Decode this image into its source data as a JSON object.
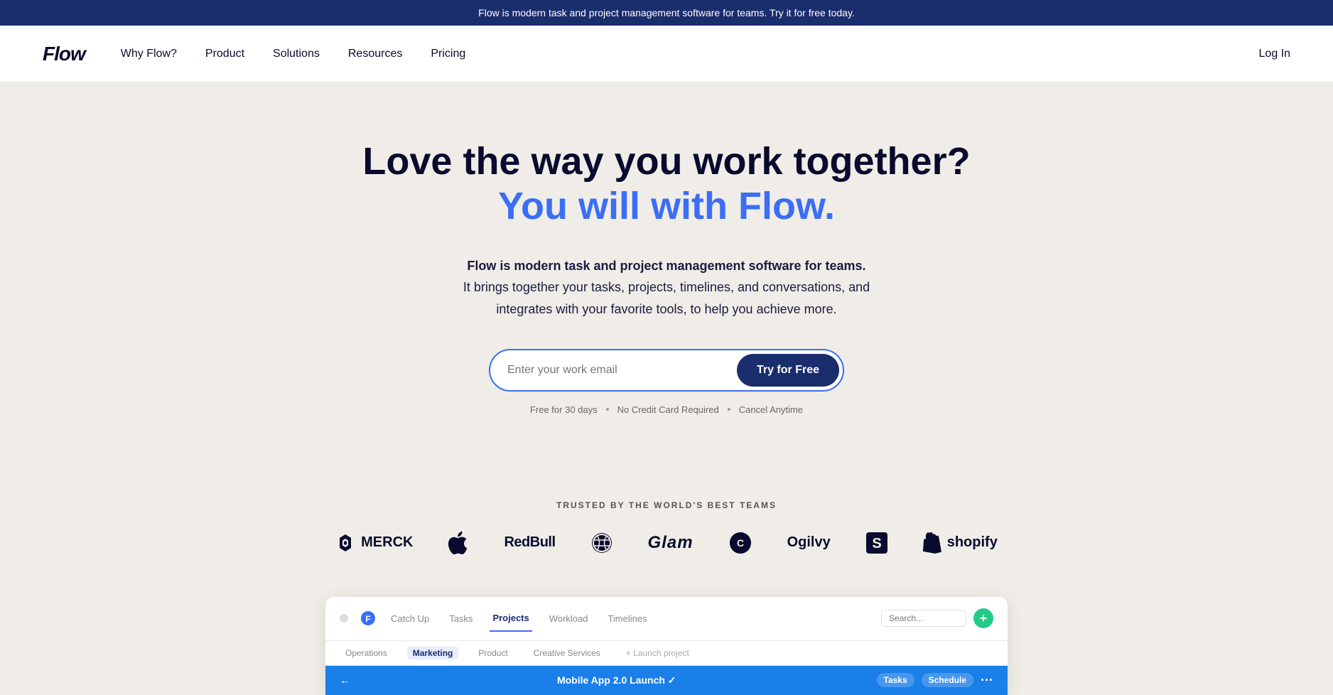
{
  "banner": {
    "text": "Flow is modern task and project management software for teams. Try it for free today."
  },
  "nav": {
    "logo": "Flow",
    "links": [
      {
        "label": "Why Flow?",
        "id": "why-flow"
      },
      {
        "label": "Product",
        "id": "product"
      },
      {
        "label": "Solutions",
        "id": "solutions"
      },
      {
        "label": "Resources",
        "id": "resources"
      },
      {
        "label": "Pricing",
        "id": "pricing"
      }
    ],
    "login": "Log In"
  },
  "hero": {
    "heading1": "Love the way you work together?",
    "heading2": "You will with Flow.",
    "subtext1": "Flow is modern task and project management software for teams.",
    "subtext2": "It brings together your tasks, projects, timelines, and conversations, and integrates with your favorite tools, to help you achieve more.",
    "email_placeholder": "Enter your work email",
    "cta_button": "Try for Free",
    "meta1": "Free for 30 days",
    "meta2": "No Credit Card Required",
    "meta3": "Cancel Anytime"
  },
  "trusted": {
    "label": "TRUSTED BY THE WORLD'S BEST TEAMS",
    "logos": [
      {
        "name": "Merck",
        "id": "merck"
      },
      {
        "name": "Apple",
        "id": "apple"
      },
      {
        "name": "RedBull",
        "id": "redbull"
      },
      {
        "name": "Dribbble",
        "id": "dribbble"
      },
      {
        "name": "Glam",
        "id": "glam"
      },
      {
        "name": "Carhartt",
        "id": "carhartt"
      },
      {
        "name": "Ogilvy",
        "id": "ogilvy"
      },
      {
        "name": "Scribd",
        "id": "scribd"
      },
      {
        "name": "Shopify",
        "id": "shopify"
      }
    ]
  },
  "app_preview": {
    "tabs": [
      "Catch Up",
      "Tasks",
      "Projects",
      "Workload",
      "Timelines"
    ],
    "active_tab": "Projects",
    "subtabs": [
      "Operations",
      "Marketing",
      "Product",
      "Creative Services"
    ],
    "active_subtab": "Marketing",
    "project_name": "Mobile App 2.0 Launch ✓",
    "project_tags": [
      "Tasks",
      "Schedule"
    ],
    "search_placeholder": "Search..."
  }
}
